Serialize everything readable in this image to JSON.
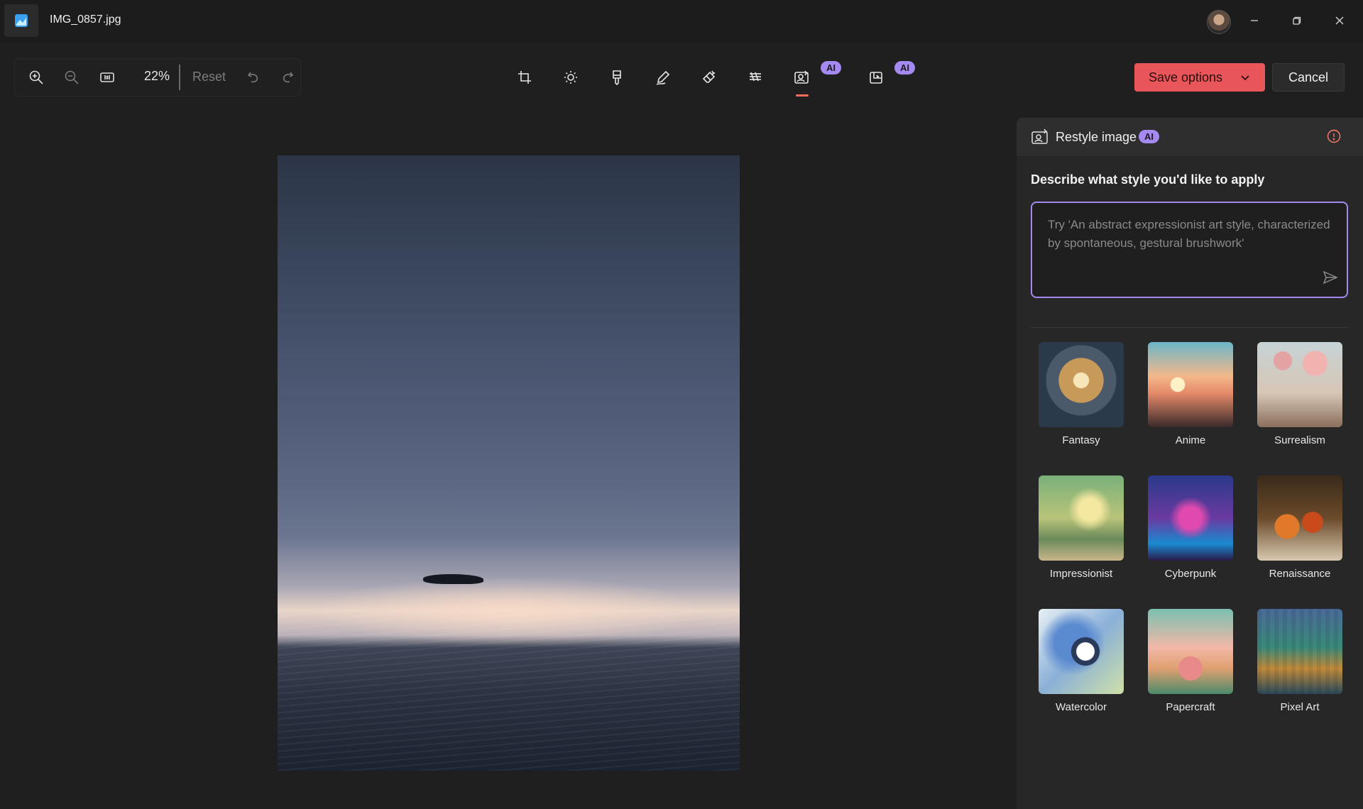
{
  "titlebar": {
    "file_name": "IMG_0857.jpg",
    "app_icon": "photos-app-icon",
    "controls": [
      "minimize-icon",
      "restore-icon",
      "close-icon"
    ]
  },
  "zoom_bar": {
    "icons": [
      "zoom-in-icon",
      "zoom-out-icon",
      "actual-size-icon",
      "undo-icon",
      "redo-icon"
    ],
    "zoom_level": "22%",
    "reset_label": "Reset"
  },
  "tools": {
    "items": [
      "crop-icon",
      "adjust-brightness-icon",
      "filter-icon",
      "markup-icon",
      "erase-icon",
      "background-blur-icon",
      "restyle-image-icon",
      "generative-fill-icon"
    ],
    "active": "restyle-image-icon",
    "ai_badge": "AI"
  },
  "actions": {
    "save_label": "Save options",
    "cancel_label": "Cancel"
  },
  "panel": {
    "title": "Restyle image",
    "ai_badge": "AI",
    "prompt_label": "Describe what style you'd like to apply",
    "prompt_placeholder": "Try 'An abstract expressionist art style, characterized by spontaneous, gestural brushwork'",
    "prompt_value": "",
    "styles": [
      {
        "label": "Fantasy"
      },
      {
        "label": "Anime"
      },
      {
        "label": "Surrealism"
      },
      {
        "label": "Impressionist"
      },
      {
        "label": "Cyberpunk"
      },
      {
        "label": "Renaissance"
      },
      {
        "label": "Watercolor"
      },
      {
        "label": "Papercraft"
      },
      {
        "label": "Pixel Art"
      }
    ]
  },
  "colors": {
    "accent_save": "#e8565a",
    "ai_badge": "#a48af0",
    "active_underline": "#ff6b5c"
  }
}
